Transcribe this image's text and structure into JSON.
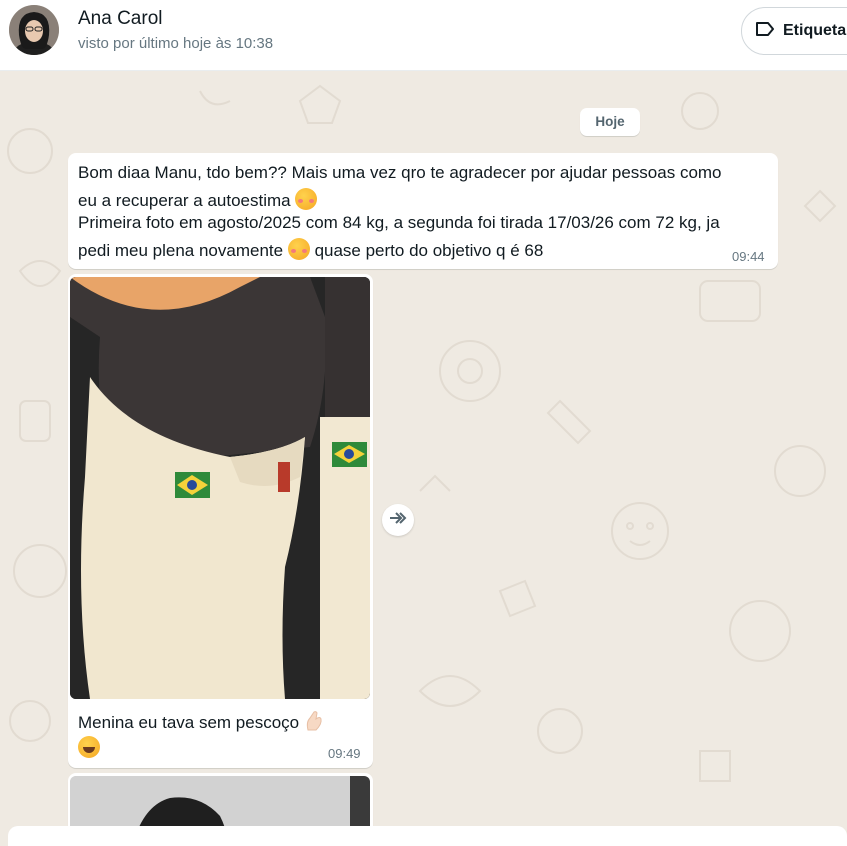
{
  "header": {
    "contact_name": "Ana Carol",
    "last_seen": "visto por último hoje às 10:38",
    "label_button": "Etiqueta"
  },
  "chat": {
    "day_divider": "Hoje",
    "messages": [
      {
        "lines": [
          "Bom diaa Manu, tdo bem?? Mais uma vez qro te agradecer por ajudar pessoas como",
          "eu a recuperar a autoestima",
          "Primeira foto em agosto/2025 com 84 kg, a segunda foi tirada 17/03/26 com 72 kg, ja",
          "pedi meu plena novamente",
          "quase perto do objetivo q é 68"
        ],
        "emoji": "smiling-face-with-hearts",
        "time": "09:44"
      },
      {
        "caption": "Menina eu tava sem pescoço",
        "emoji_hand": "pinching-hand",
        "emoji_laugh": "grinning-face-with-sweat",
        "time": "09:49"
      }
    ]
  },
  "icons": {
    "label_icon": "label-tag-icon",
    "forward_icon": "forward-icon"
  }
}
